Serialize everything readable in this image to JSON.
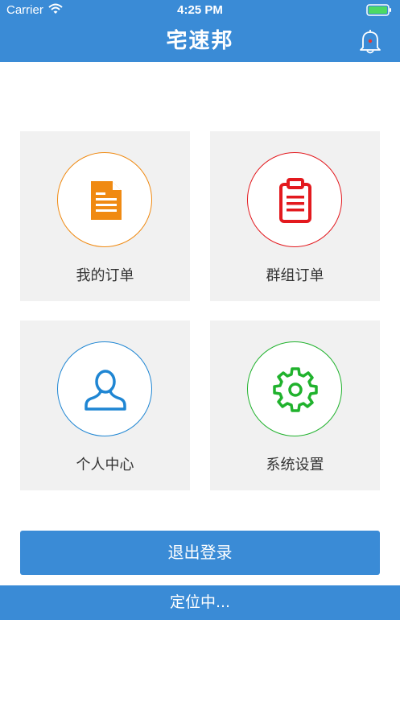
{
  "status_bar": {
    "carrier": "Carrier",
    "time": "4:25 PM"
  },
  "header": {
    "title": "宅速邦",
    "bell_icon": "bell-icon",
    "bell_dot_color": "#e53935"
  },
  "colors": {
    "brand": "#3a8bd6",
    "tile_bg": "#f1f1f1"
  },
  "tiles": [
    {
      "label": "我的订单",
      "icon": "document-icon",
      "color": "#f08a12"
    },
    {
      "label": "群组订单",
      "icon": "clipboard-icon",
      "color": "#e3191e"
    },
    {
      "label": "个人中心",
      "icon": "user-icon",
      "color": "#1f86d3"
    },
    {
      "label": "系统设置",
      "icon": "gear-icon",
      "color": "#20b22d"
    }
  ],
  "logout_label": "退出登录",
  "location_status": "定位中..."
}
